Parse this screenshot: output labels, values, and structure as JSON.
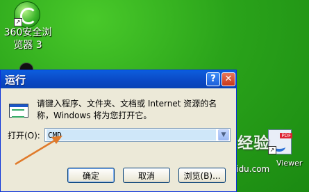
{
  "desktop": {
    "icons": [
      {
        "label_line1": "360安全浏",
        "label_line2": "览器 3"
      },
      {
        "label": "Viewer"
      }
    ],
    "watermark": "Bai经验",
    "watermark_sub": "Aijaidu.com"
  },
  "dialog": {
    "title": "运行",
    "help_glyph": "?",
    "close_glyph": "✕",
    "description": "请键入程序、文件夹、文档或 Internet 资源的名称，Windows 将为您打开它。",
    "open_label": "打开(O):",
    "input_value": "CMD",
    "dropdown_glyph": "▼",
    "buttons": {
      "ok": "确定",
      "cancel": "取消",
      "browse": "浏览(B)..."
    }
  },
  "colors": {
    "titlebar": "#0a5fe0",
    "annotation_arrow": "#e07a2a",
    "desktop_green": "#2aa31a"
  }
}
